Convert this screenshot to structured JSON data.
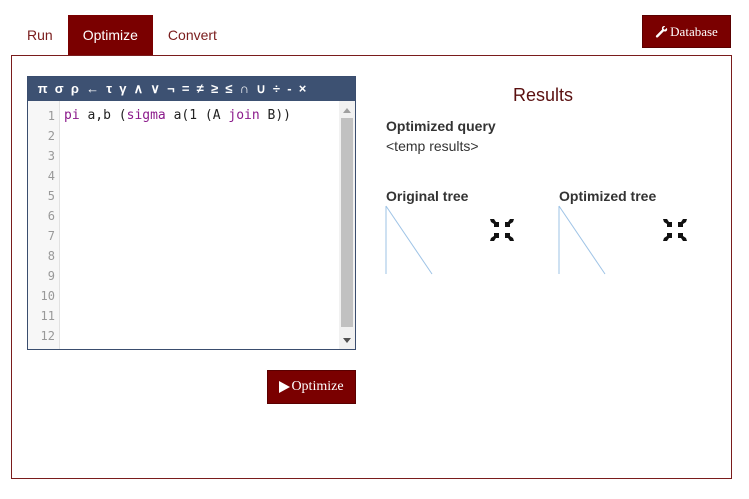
{
  "tabs": [
    {
      "label": "Run",
      "active": false
    },
    {
      "label": "Optimize",
      "active": true
    },
    {
      "label": "Convert",
      "active": false
    }
  ],
  "database_button": {
    "label": "Database",
    "icon": "wrench-icon"
  },
  "editor": {
    "symbols": [
      "π",
      "σ",
      "ρ",
      "←",
      "τ",
      "γ",
      "∧",
      "∨",
      "¬",
      "=",
      "≠",
      "≥",
      "≤",
      "∩",
      "∪",
      "÷",
      "-",
      "×"
    ],
    "line_numbers": [
      "1",
      "2",
      "3",
      "4",
      "5",
      "6",
      "7",
      "8",
      "9",
      "10",
      "11",
      "12"
    ],
    "code": {
      "kw1": "pi",
      "t1": " a,b (",
      "kw2": "sigma",
      "t2": " a(1 (A ",
      "kw3": "join",
      "t3": " B))"
    }
  },
  "optimize_button": {
    "label": "Optimize",
    "icon": "play-icon"
  },
  "results": {
    "title": "Results",
    "optimized_query_label": "Optimized query",
    "optimized_query_value": "<temp results>",
    "original_tree_label": "Original tree",
    "optimized_tree_label": "Optimized tree"
  },
  "colors": {
    "accent": "#7a0000",
    "symbol_bar": "#3d5172",
    "tree_line": "#9ec3e6"
  }
}
